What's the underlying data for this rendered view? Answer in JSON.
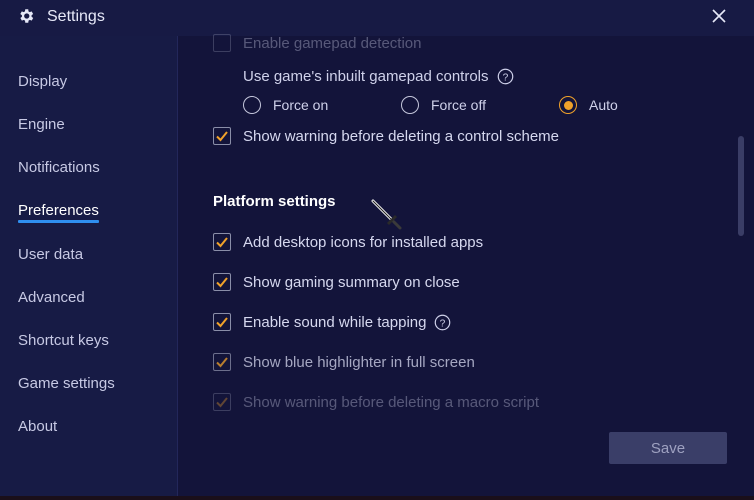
{
  "window": {
    "title": "Settings"
  },
  "sidebar": {
    "items": [
      {
        "label": "Display"
      },
      {
        "label": "Engine"
      },
      {
        "label": "Notifications"
      },
      {
        "label": "Preferences"
      },
      {
        "label": "User data"
      },
      {
        "label": "Advanced"
      },
      {
        "label": "Shortcut keys"
      },
      {
        "label": "Game settings"
      },
      {
        "label": "About"
      }
    ],
    "active": "Preferences"
  },
  "gamepad": {
    "enable_label": "Enable gamepad detection",
    "inbuilt_label": "Use game's inbuilt gamepad controls",
    "options": [
      {
        "label": "Force on",
        "selected": false
      },
      {
        "label": "Force off",
        "selected": false
      },
      {
        "label": "Auto",
        "selected": true
      }
    ],
    "warning_label": "Show warning before deleting a control scheme",
    "warning_checked": true
  },
  "platform": {
    "title": "Platform settings",
    "options": [
      {
        "label": "Add desktop icons for installed apps",
        "checked": true
      },
      {
        "label": "Show gaming summary on close",
        "checked": true
      },
      {
        "label": "Enable sound while tapping",
        "checked": true
      },
      {
        "label": "Show blue highlighter in full screen",
        "checked": true
      },
      {
        "label": "Show warning before deleting a macro script",
        "checked": true
      }
    ]
  },
  "footer": {
    "save_label": "Save"
  },
  "colors": {
    "accent": "#f0a12a",
    "tab_underline": "#2f8ff0",
    "background": "#13143a"
  },
  "icons": [
    "gear-icon",
    "close-icon",
    "help-icon",
    "sword-cursor-icon"
  ]
}
